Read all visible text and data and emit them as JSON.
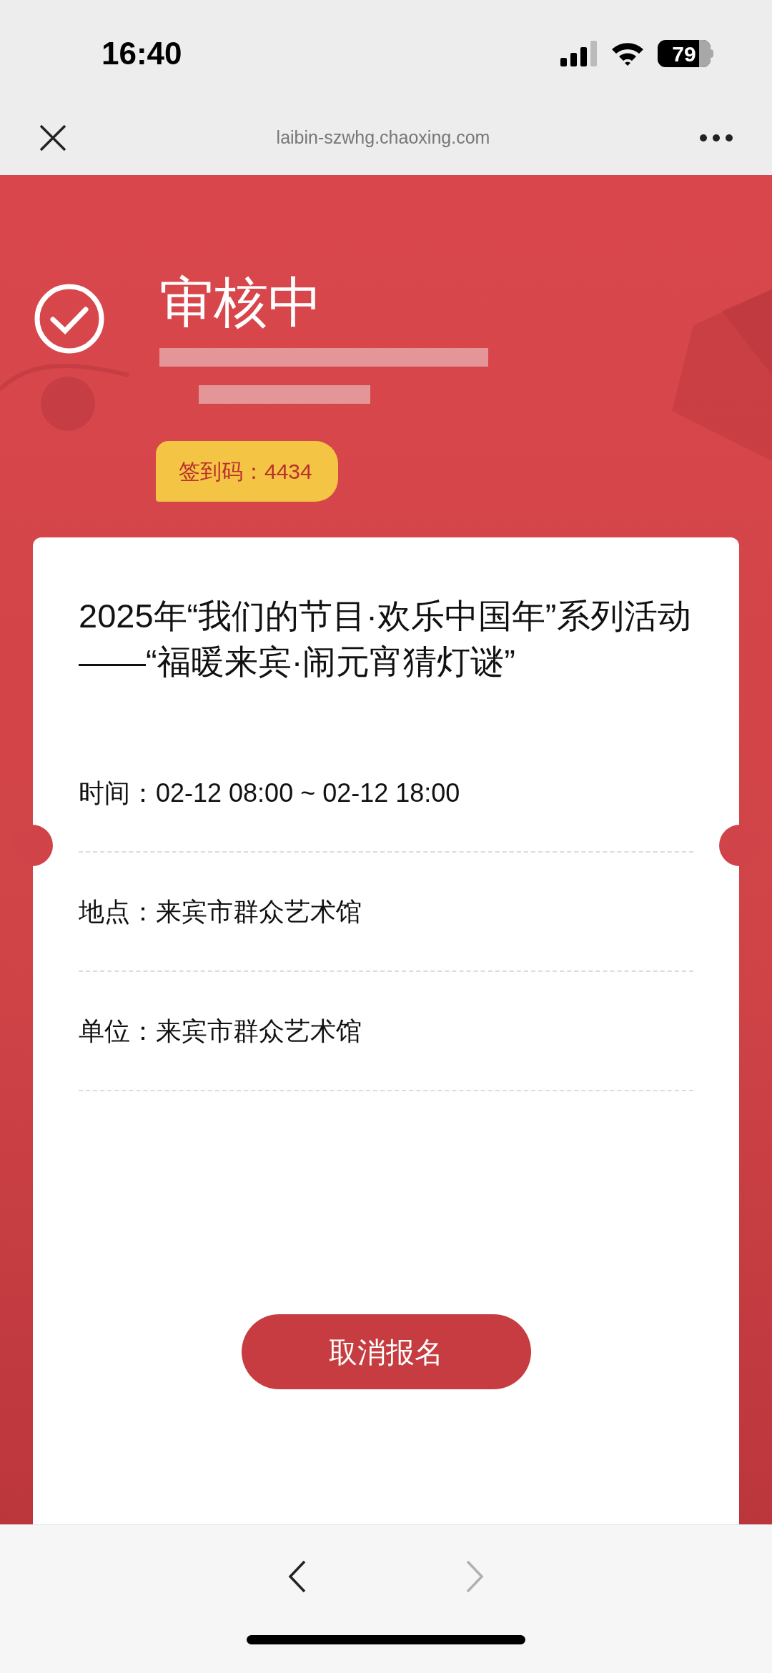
{
  "status_bar": {
    "time": "16:40",
    "battery": "79"
  },
  "browser": {
    "url": "laibin-szwhg.chaoxing.com"
  },
  "header": {
    "status": "审核中",
    "checkin_code": "签到码：4434"
  },
  "card": {
    "title": "2025年“我们的节目·欢乐中国年”系列活动——“福暖来宾·闹元宵猜灯谜”",
    "details": [
      {
        "label": "时间：",
        "value": "02-12 08:00 ~ 02-12 18:00"
      },
      {
        "label": "地点：",
        "value": "来宾市群众艺术馆"
      },
      {
        "label": "单位：",
        "value": "来宾市群众艺术馆"
      }
    ],
    "button": "取消报名"
  },
  "toolbar": {
    "back": {
      "disabled": false
    },
    "forward": {
      "disabled": true
    }
  }
}
